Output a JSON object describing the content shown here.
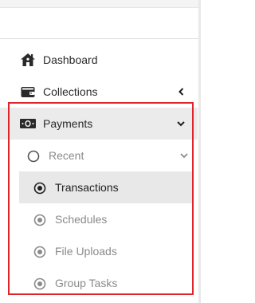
{
  "sidebar": {
    "items": [
      {
        "label": "Dashboard",
        "icon": "home-icon"
      },
      {
        "label": "Collections",
        "icon": "wallet-icon"
      },
      {
        "label": "Payments",
        "icon": "money-icon"
      }
    ],
    "payments_submenu": {
      "group_label": "Recent",
      "items": [
        {
          "label": "Transactions",
          "selected": true
        },
        {
          "label": "Schedules"
        },
        {
          "label": "File Uploads"
        },
        {
          "label": "Group Tasks"
        }
      ]
    }
  },
  "colors": {
    "highlight_border": "#e0242b",
    "active_background": "#e8e8e8",
    "muted_text": "#8a8a8a",
    "primary_text": "#2b2b2b"
  }
}
